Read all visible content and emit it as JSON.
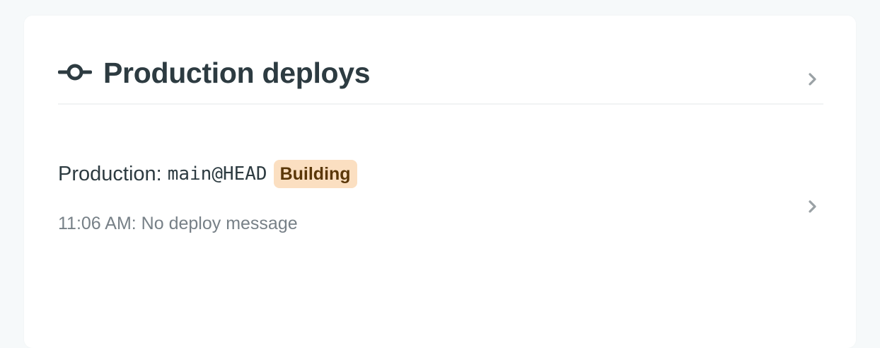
{
  "card": {
    "title": "Production deploys",
    "title_icon": "git-commit-icon",
    "chevron_icon": "chevron-right-icon"
  },
  "deploys": [
    {
      "context_label": "Production:",
      "branch_ref": "main@HEAD",
      "status": "Building",
      "time": "11:06 AM:",
      "message": "No deploy message",
      "chevron_icon": "chevron-right-icon"
    }
  ],
  "colors": {
    "background": "#f6f9fa",
    "card": "#ffffff",
    "text_primary": "#2d3b41",
    "text_secondary": "#778087",
    "status_building_bg": "#fbdfc1",
    "status_building_text": "#5a3708",
    "chevron": "#9aa1a5"
  }
}
